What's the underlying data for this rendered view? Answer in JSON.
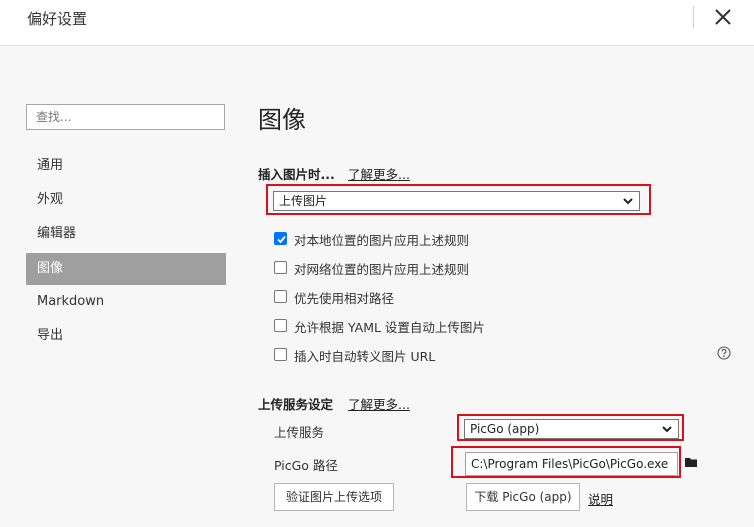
{
  "window": {
    "title": "偏好设置"
  },
  "sidebar": {
    "search_placeholder": "查找...",
    "items": [
      {
        "label": "通用",
        "active": false
      },
      {
        "label": "外观",
        "active": false
      },
      {
        "label": "编辑器",
        "active": false
      },
      {
        "label": "图像",
        "active": true
      },
      {
        "label": "Markdown",
        "active": false
      },
      {
        "label": "导出",
        "active": false
      }
    ]
  },
  "main": {
    "title": "图像",
    "insert_image": {
      "label": "插入图片时...",
      "learn_more": "了解更多...",
      "select_value": "上传图片"
    },
    "options": [
      {
        "label": "对本地位置的图片应用上述规则",
        "checked": true
      },
      {
        "label": "对网络位置的图片应用上述规则",
        "checked": false
      },
      {
        "label": "优先使用相对路径",
        "checked": false
      },
      {
        "label": "允许根据 YAML 设置自动上传图片",
        "checked": false
      },
      {
        "label": "插入时自动转义图片 URL",
        "checked": false
      }
    ],
    "upload": {
      "label": "上传服务设定",
      "learn_more": "了解更多...",
      "service_label": "上传服务",
      "service_value": "PicGo (app)",
      "path_label": "PicGo 路径",
      "path_value": "C:\\Program Files\\PicGo\\PicGo.exe",
      "verify_button": "验证图片上传选项",
      "download_button": "下载 PicGo (app)",
      "explain_link": "说明"
    }
  },
  "colors": {
    "highlight": "#d9111d",
    "checkbox": "#0075ff",
    "active_nav": "#9f9f9f"
  },
  "icons": [
    "close-icon",
    "chevron-down-icon",
    "check-icon",
    "help-icon",
    "folder-icon"
  ]
}
